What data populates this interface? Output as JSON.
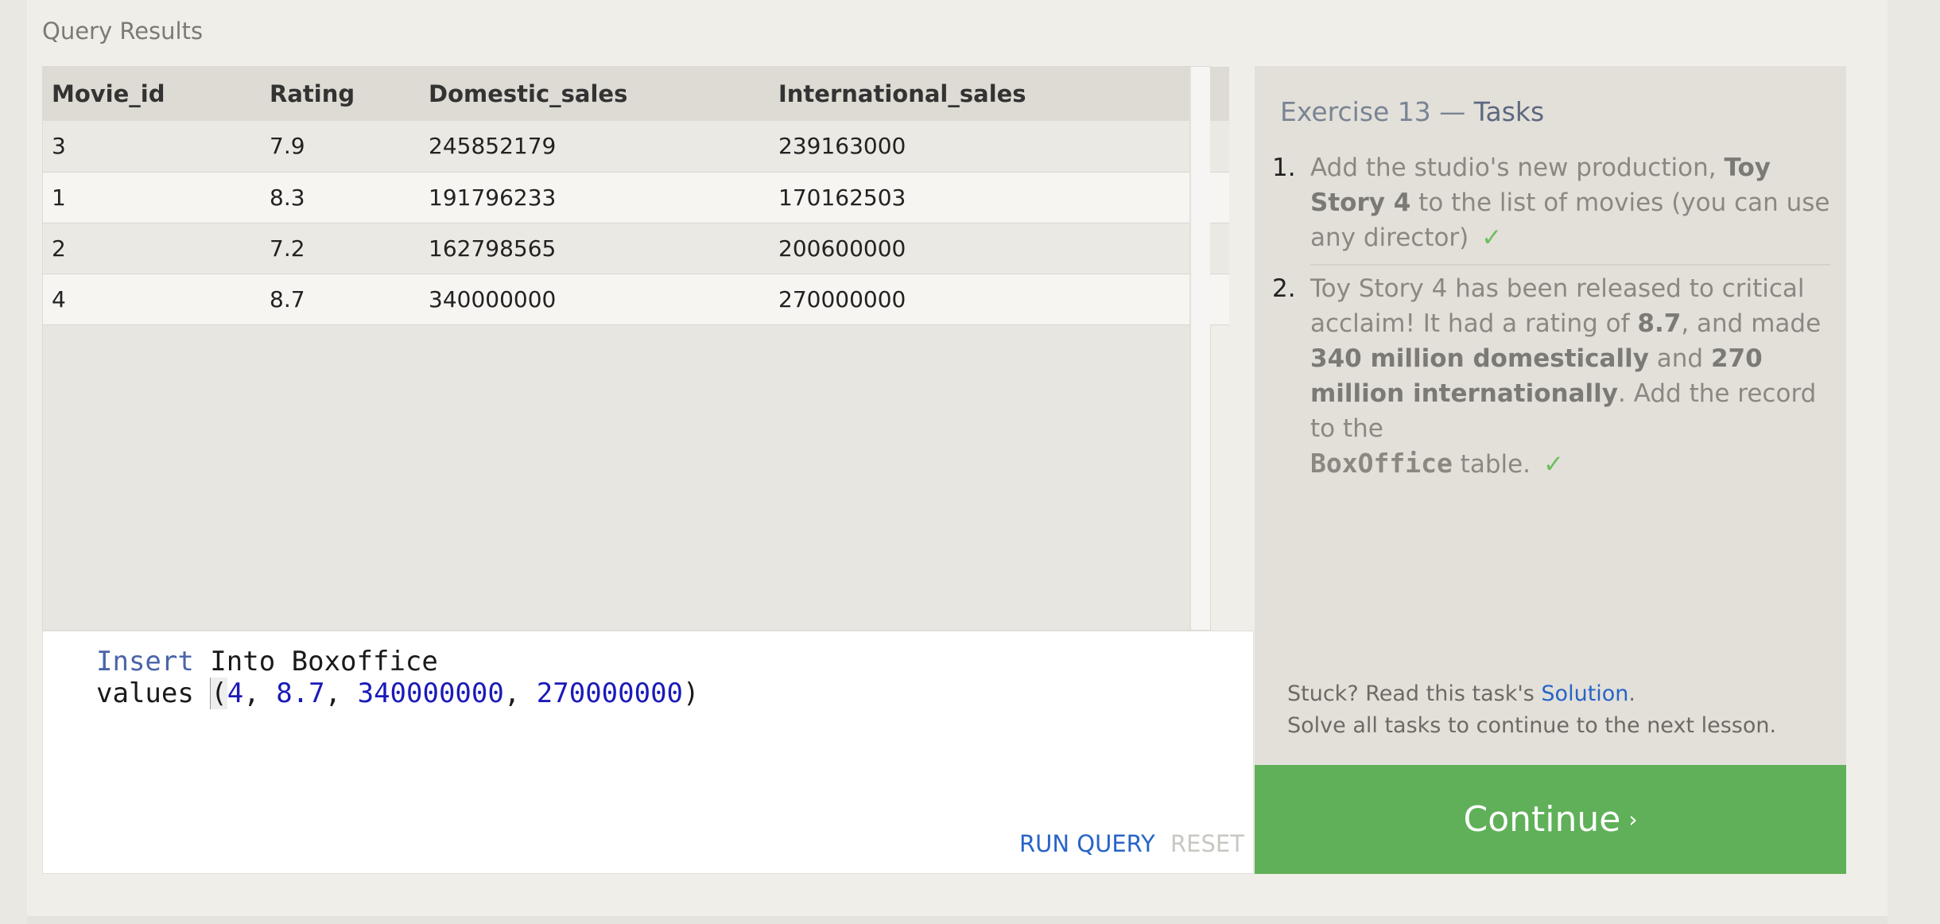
{
  "section_title": "Query Results",
  "table": {
    "headers": [
      "Movie_id",
      "Rating",
      "Domestic_sales",
      "International_sales"
    ],
    "rows": [
      [
        "3",
        "7.9",
        "245852179",
        "239163000"
      ],
      [
        "1",
        "8.3",
        "191796233",
        "170162503"
      ],
      [
        "2",
        "7.2",
        "162798565",
        "200600000"
      ],
      [
        "4",
        "8.7",
        "340000000",
        "270000000"
      ]
    ]
  },
  "editor": {
    "line1_keyword": "Insert",
    "line1_rest": " Into Boxoffice",
    "line2_prefix": "values ",
    "paren_open": "(",
    "v1": "4",
    "v2": "8.7",
    "v3": "340000000",
    "v4": "270000000",
    "sep": ", ",
    "paren_close": ")",
    "run_label": "RUN QUERY",
    "reset_label": "RESET"
  },
  "tasks": {
    "title_prefix": "Exercise 13 — ",
    "title_bold": "Tasks",
    "items": [
      {
        "number": "1.",
        "text_a": "Add the studio's new production, ",
        "bold_a": "Toy Story 4",
        "text_b": " to the list of movies (you can use any director)",
        "check": "✓"
      },
      {
        "number": "2.",
        "text_a": "Toy Story 4 has been released to critical acclaim! It had a rating of ",
        "bold_a": "8.7",
        "text_b": ", and made ",
        "bold_b": "340 million domestically",
        "text_c": " and ",
        "bold_c": "270 million internationally",
        "text_d": ". Add the record to the ",
        "code": "BoxOffice",
        "text_e": " table.",
        "check": "✓"
      }
    ],
    "stuck_prefix": "Stuck? Read this task's ",
    "solution_link": "Solution",
    "stuck_suffix": ".",
    "solve_all": "Solve all tasks to continue to the next lesson."
  },
  "continue_label": "Continue",
  "continue_arrow": "›",
  "colors": {
    "continue_bg": "#5fb058",
    "link": "#2764c8",
    "check": "#6cbf5f"
  }
}
